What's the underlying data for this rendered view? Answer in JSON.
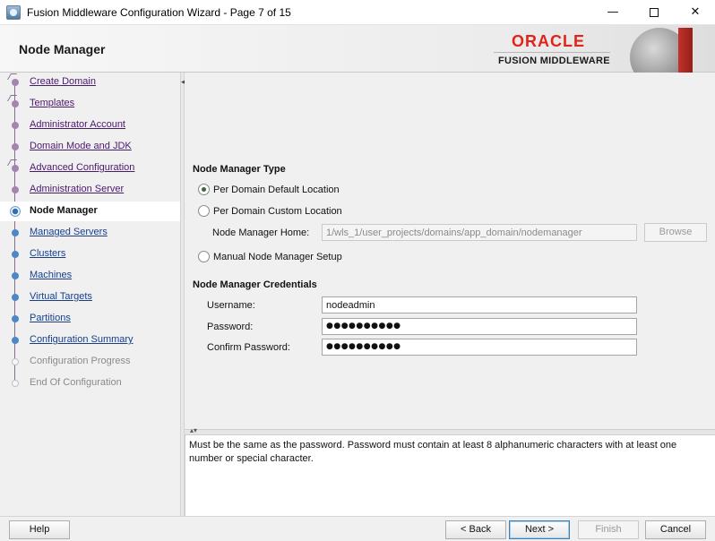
{
  "window": {
    "title": "Fusion Middleware Configuration Wizard - Page 7 of 15",
    "minimize_glyph": "—",
    "close_glyph": "✕"
  },
  "header": {
    "page_title": "Node Manager",
    "brand": "ORACLE",
    "product": "FUSION MIDDLEWARE"
  },
  "nav": {
    "items": [
      {
        "label": "Create Domain",
        "state": "done"
      },
      {
        "label": "Templates",
        "state": "done"
      },
      {
        "label": "Administrator Account",
        "state": "done"
      },
      {
        "label": "Domain Mode and JDK",
        "state": "done"
      },
      {
        "label": "Advanced Configuration",
        "state": "done"
      },
      {
        "label": "Administration Server",
        "state": "done"
      },
      {
        "label": "Node Manager",
        "state": "current"
      },
      {
        "label": "Managed Servers",
        "state": "todo"
      },
      {
        "label": "Clusters",
        "state": "todo"
      },
      {
        "label": "Machines",
        "state": "todo"
      },
      {
        "label": "Virtual Targets",
        "state": "todo"
      },
      {
        "label": "Partitions",
        "state": "todo"
      },
      {
        "label": "Configuration Summary",
        "state": "todo"
      },
      {
        "label": "Configuration Progress",
        "state": "inactive"
      },
      {
        "label": "End Of Configuration",
        "state": "inactive"
      }
    ]
  },
  "node_manager_type": {
    "title": "Node Manager Type",
    "option_per_domain_default": "Per Domain Default Location",
    "option_per_domain_custom": "Per Domain Custom Location",
    "home_label": "Node Manager Home:",
    "home_value": "1/wls_1/user_projects/domains/app_domain/nodemanager",
    "browse_label": "Browse",
    "option_manual": "Manual Node Manager Setup",
    "selected": "Per Domain Default Location"
  },
  "credentials": {
    "title": "Node Manager Credentials",
    "username_label": "Username:",
    "username_value": "nodeadmin",
    "password_label": "Password:",
    "password_value": "●●●●●●●●●●",
    "confirm_label": "Confirm Password:",
    "confirm_value": "●●●●●●●●●●"
  },
  "help_text": "Must be the same as the password. Password must contain at least 8 alphanumeric characters with at least one number or special character.",
  "buttons": {
    "help": "Help",
    "back": "< Back",
    "next": "Next >",
    "finish": "Finish",
    "cancel": "Cancel"
  }
}
